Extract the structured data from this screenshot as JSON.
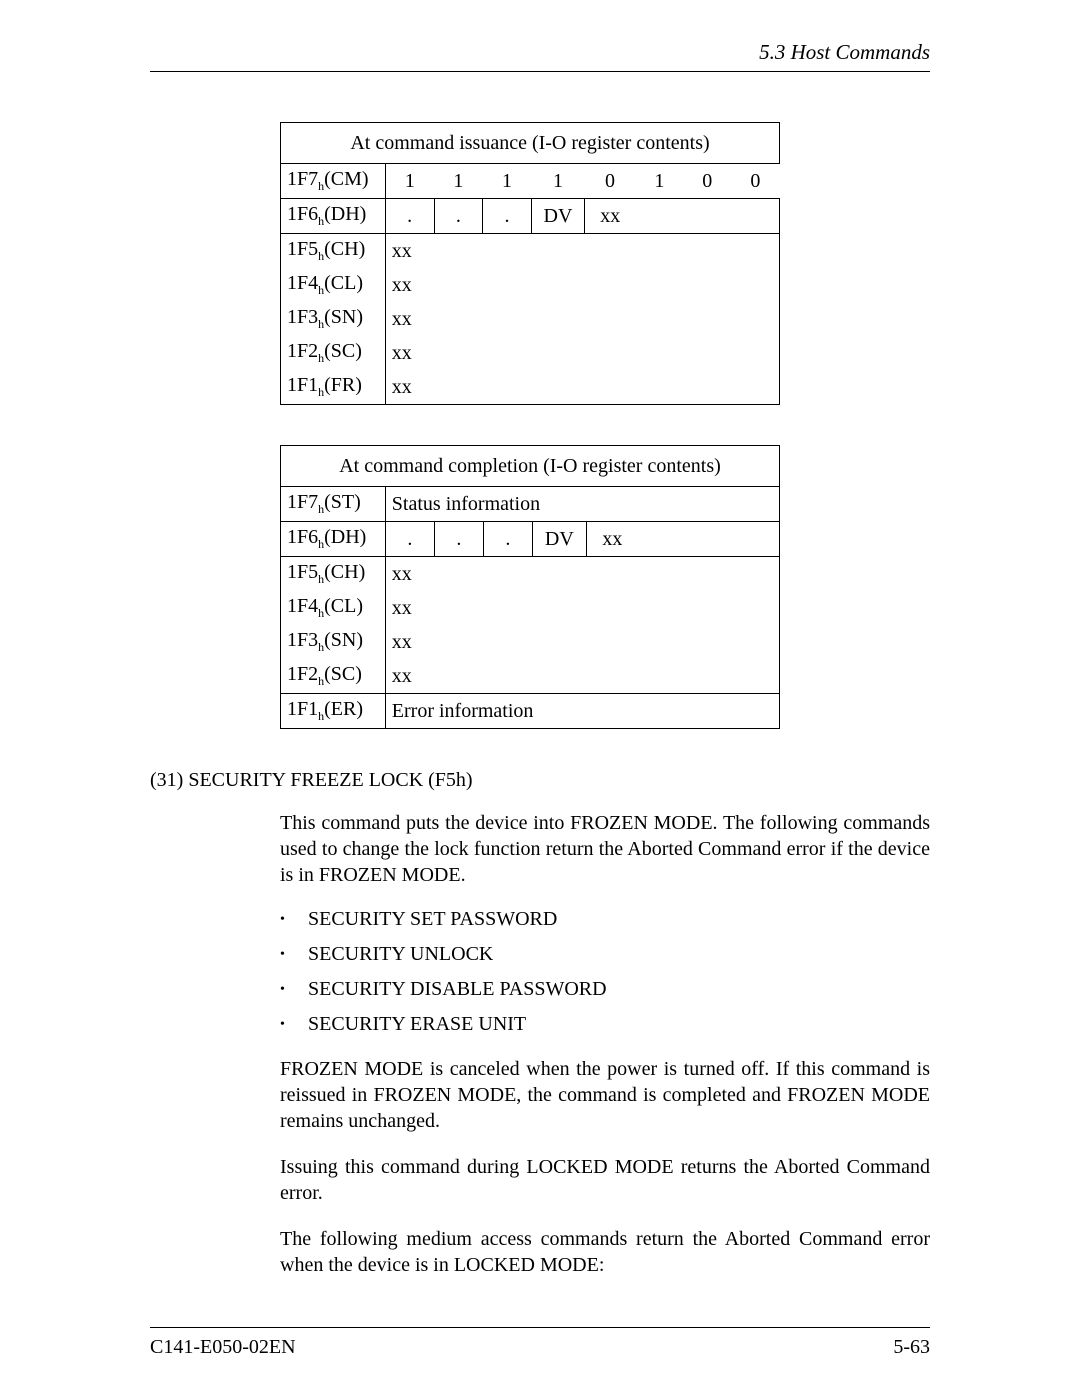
{
  "header": {
    "section": "5.3  Host Commands"
  },
  "table1": {
    "title": "At command issuance (I-O register contents)",
    "rows": {
      "r1": {
        "label_pre": "1F7",
        "label_sub": "h",
        "label_post": "(CM)",
        "bits": [
          "1",
          "1",
          "1",
          "1",
          "0",
          "1",
          "0",
          "0"
        ]
      },
      "r2": {
        "label_pre": "1F6",
        "label_sub": "h",
        "label_post": "(DH)",
        "bits": [
          ".",
          ".",
          ".",
          "DV",
          "xx",
          "",
          "",
          ""
        ]
      },
      "r3": {
        "label_pre": "1F5",
        "label_sub": "h",
        "label_post": "(CH)",
        "content": "xx"
      },
      "r4": {
        "label_pre": "1F4",
        "label_sub": "h",
        "label_post": "(CL)",
        "content": "xx"
      },
      "r5": {
        "label_pre": "1F3",
        "label_sub": "h",
        "label_post": "(SN)",
        "content": "xx"
      },
      "r6": {
        "label_pre": "1F2",
        "label_sub": "h",
        "label_post": "(SC)",
        "content": "xx"
      },
      "r7": {
        "label_pre": "1F1",
        "label_sub": "h",
        "label_post": "(FR)",
        "content": "xx"
      }
    }
  },
  "table2": {
    "title": "At command completion (I-O register contents)",
    "rows": {
      "r1": {
        "label_pre": "1F7",
        "label_sub": "h",
        "label_post": "(ST)",
        "content": "Status information"
      },
      "r2": {
        "label_pre": "1F6",
        "label_sub": "h",
        "label_post": "(DH)",
        "bits": [
          ".",
          ".",
          ".",
          "DV",
          "xx",
          "",
          "",
          ""
        ]
      },
      "r3": {
        "label_pre": "1F5",
        "label_sub": "h",
        "label_post": "(CH)",
        "content": "xx"
      },
      "r4": {
        "label_pre": "1F4",
        "label_sub": "h",
        "label_post": "(CL)",
        "content": "xx"
      },
      "r5": {
        "label_pre": "1F3",
        "label_sub": "h",
        "label_post": "(SN)",
        "content": "xx"
      },
      "r6": {
        "label_pre": "1F2",
        "label_sub": "h",
        "label_post": "(SC)",
        "content": "xx"
      },
      "r7": {
        "label_pre": "1F1",
        "label_sub": "h",
        "label_post": "(ER)",
        "content": "Error information"
      }
    }
  },
  "section": {
    "heading": "(31)  SECURITY FREEZE LOCK (F5h)",
    "p1": "This command puts the device into FROZEN MODE.  The following commands used to change the lock function return the Aborted Command error if the device is in FROZEN MODE.",
    "bullets": {
      "b1": "SECURITY SET PASSWORD",
      "b2": "SECURITY UNLOCK",
      "b3": "SECURITY DISABLE PASSWORD",
      "b4": "SECURITY ERASE UNIT"
    },
    "p2": "FROZEN MODE is canceled when the power is turned off.  If this command is reissued in FROZEN MODE, the command is completed and FROZEN MODE remains unchanged.",
    "p3": "Issuing this command during LOCKED MODE returns the Aborted Command error.",
    "p4": "The following medium access commands return the Aborted Command error when the device is in LOCKED MODE:"
  },
  "footer": {
    "left": "C141-E050-02EN",
    "right": "5-63"
  }
}
